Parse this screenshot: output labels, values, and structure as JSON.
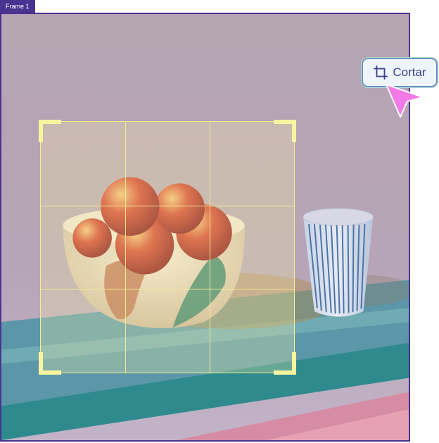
{
  "frame": {
    "label": "Frame 1"
  },
  "toolbar": {
    "crop_label": "Cortar",
    "crop_icon": "crop-icon"
  },
  "cursor": {
    "icon": "pointer-cursor-icon",
    "color": "#f27ae6"
  },
  "crop": {
    "grid_rows": 3,
    "grid_cols": 3,
    "handle_color": "#f8f4a0"
  },
  "colors": {
    "frame_border": "#4a3291",
    "button_border": "#6b8fc9",
    "button_text": "#3b3f8f"
  }
}
